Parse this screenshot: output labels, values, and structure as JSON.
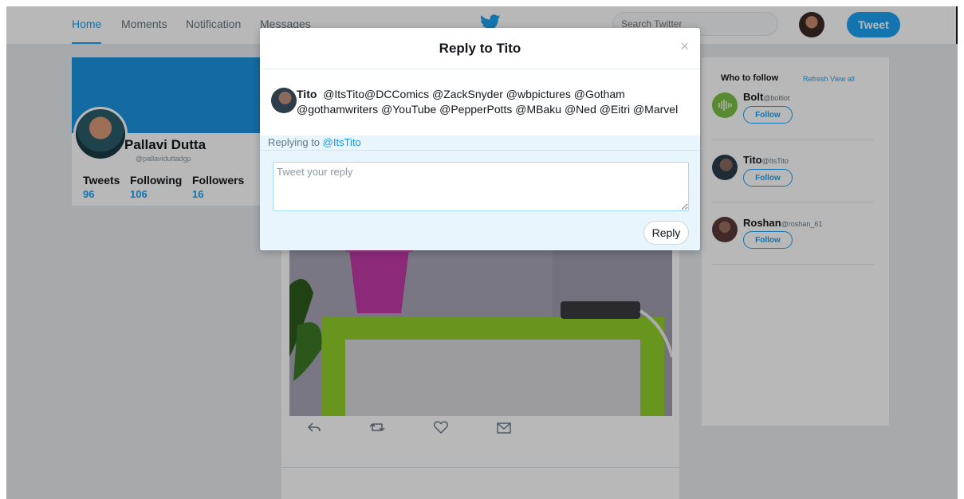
{
  "nav": {
    "home": "Home",
    "moments": "Moments",
    "notification": "Notification",
    "messages": "Messages",
    "search_placeholder": "Search Twitter",
    "tweet_label": "Tweet"
  },
  "profile": {
    "name": "Pallavi Dutta",
    "handle": "@pallaviduttadgp",
    "stats": [
      {
        "label": "Tweets",
        "value": "96"
      },
      {
        "label": "Following",
        "value": "106"
      },
      {
        "label": "Followers",
        "value": "16"
      }
    ]
  },
  "who_to_follow": {
    "title": "Who to follow",
    "refresh": "Refresh",
    "view_all": "View all",
    "follow_label": "Follow",
    "items": [
      {
        "name": "Bolt",
        "handle": "@boltiot"
      },
      {
        "name": "Tito",
        "handle": "@ItsTito"
      },
      {
        "name": "Roshan",
        "handle": "@roshan_61"
      }
    ]
  },
  "modal": {
    "title": "Reply to Tito",
    "close": "×",
    "author": "Tito",
    "mentions": "@ItsTito@DCComics @ZackSnyder @wbpictures @Gotham @gothamwriters @YouTube @PepperPotts @MBaku @Ned @Eitri @Marvel",
    "replying_prefix": "Replying to",
    "replying_handle": "@ItsTito",
    "reply_placeholder": "Tweet your reply",
    "reply_button": "Reply"
  },
  "colors": {
    "accent": "#1da1f2",
    "background": "#e6ecf0",
    "reply_area": "#e8f5fd"
  },
  "icons": {
    "logo": "twitter-bird-icon",
    "actions": [
      "reply-icon",
      "retweet-icon",
      "like-icon",
      "message-icon"
    ]
  }
}
